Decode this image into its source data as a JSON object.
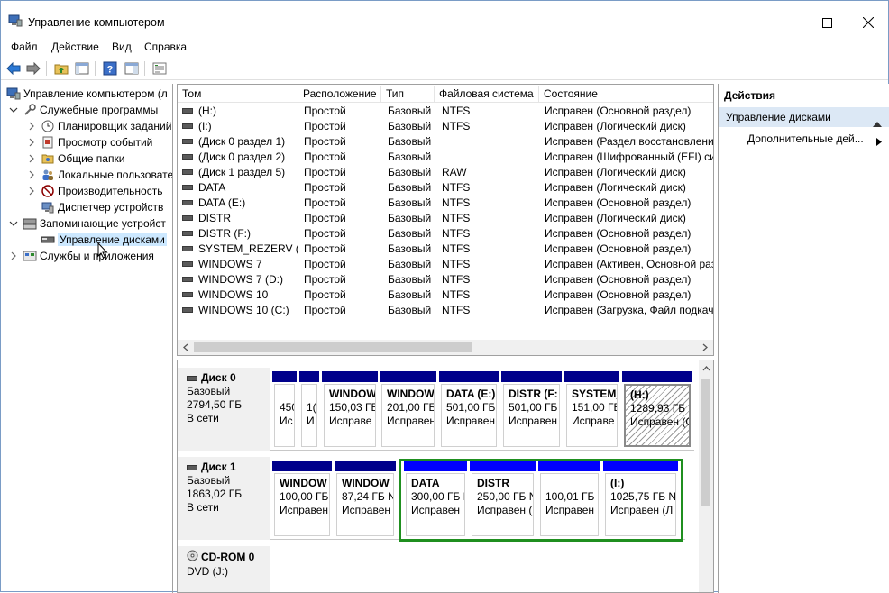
{
  "window": {
    "title": "Управление компьютером"
  },
  "menu": [
    "Файл",
    "Действие",
    "Вид",
    "Справка"
  ],
  "tree": {
    "root": "Управление компьютером (л",
    "items": [
      {
        "label": "Служебные программы",
        "level": 1,
        "expanded": true
      },
      {
        "label": "Планировщик заданий",
        "level": 2,
        "expanded": false
      },
      {
        "label": "Просмотр событий",
        "level": 2,
        "expanded": false
      },
      {
        "label": "Общие папки",
        "level": 2,
        "expanded": false
      },
      {
        "label": "Локальные пользовате",
        "level": 2,
        "expanded": false
      },
      {
        "label": "Производительность",
        "level": 2,
        "expanded": false
      },
      {
        "label": "Диспетчер устройств",
        "level": 2
      },
      {
        "label": "Запоминающие устройст",
        "level": 1,
        "expanded": true
      },
      {
        "label": "Управление дисками",
        "level": 2,
        "selected": true
      },
      {
        "label": "Службы и приложения",
        "level": 1,
        "expanded": false
      }
    ]
  },
  "volumes": {
    "columns": [
      "Том",
      "Расположение",
      "Тип",
      "Файловая система",
      "Состояние"
    ],
    "rows": [
      [
        "(H:)",
        "Простой",
        "Базовый",
        "NTFS",
        "Исправен (Основной раздел)"
      ],
      [
        "(I:)",
        "Простой",
        "Базовый",
        "NTFS",
        "Исправен (Логический диск)"
      ],
      [
        "(Диск 0 раздел 1)",
        "Простой",
        "Базовый",
        "",
        "Исправен (Раздел восстановления"
      ],
      [
        "(Диск 0 раздел 2)",
        "Простой",
        "Базовый",
        "",
        "Исправен (Шифрованный (EFI) си"
      ],
      [
        "(Диск 1 раздел 5)",
        "Простой",
        "Базовый",
        "RAW",
        "Исправен (Логический диск)"
      ],
      [
        "DATA",
        "Простой",
        "Базовый",
        "NTFS",
        "Исправен (Логический диск)"
      ],
      [
        "DATA (E:)",
        "Простой",
        "Базовый",
        "NTFS",
        "Исправен (Основной раздел)"
      ],
      [
        "DISTR",
        "Простой",
        "Базовый",
        "NTFS",
        "Исправен (Логический диск)"
      ],
      [
        "DISTR (F:)",
        "Простой",
        "Базовый",
        "NTFS",
        "Исправен (Основной раздел)"
      ],
      [
        "SYSTEM_REZERV (G:)",
        "Простой",
        "Базовый",
        "NTFS",
        "Исправен (Основной раздел)"
      ],
      [
        "WINDOWS 7",
        "Простой",
        "Базовый",
        "NTFS",
        "Исправен (Активен, Основной раз"
      ],
      [
        "WINDOWS 7 (D:)",
        "Простой",
        "Базовый",
        "NTFS",
        "Исправен (Основной раздел)"
      ],
      [
        "WINDOWS 10",
        "Простой",
        "Базовый",
        "NTFS",
        "Исправен (Основной раздел)"
      ],
      [
        "WINDOWS 10 (C:)",
        "Простой",
        "Базовый",
        "NTFS",
        "Исправен (Загрузка, Файл подкач"
      ]
    ]
  },
  "disks": [
    {
      "name": "Диск 0",
      "type": "Базовый",
      "size": "2794,50 ГБ",
      "status": "В сети",
      "partitions": [
        {
          "name": "",
          "size": "450",
          "status": "Ис"
        },
        {
          "name": "",
          "size": "1(",
          "status": "И"
        },
        {
          "name": "WINDOW",
          "size": "150,03 ГБ",
          "status": "Исправе"
        },
        {
          "name": "WINDOW",
          "size": "201,00 ГБ",
          "status": "Исправен"
        },
        {
          "name": "DATA  (E:)",
          "size": "501,00 ГБ",
          "status": "Исправен"
        },
        {
          "name": "DISTR  (F:",
          "size": "501,00 ГБ",
          "status": "Исправен"
        },
        {
          "name": "SYSTEM_",
          "size": "151,00 ГБ",
          "status": "Исправе"
        },
        {
          "name": "(H:)",
          "size": "1289,93 ГБ N",
          "status": "Исправен (С"
        }
      ]
    },
    {
      "name": "Диск 1",
      "type": "Базовый",
      "size": "1863,02 ГБ",
      "status": "В сети",
      "partitions": [
        {
          "name": "WINDOW",
          "size": "100,00 ГБ N",
          "status": "Исправен"
        },
        {
          "name": "WINDOW",
          "size": "87,24 ГБ N",
          "status": "Исправен"
        },
        {
          "name": "DATA",
          "size": "300,00 ГБ N",
          "status": "Исправен"
        },
        {
          "name": "DISTR",
          "size": "250,00 ГБ N",
          "status": "Исправен ("
        },
        {
          "name": "",
          "size": "100,01 ГБ F",
          "status": "Исправен"
        },
        {
          "name": "(I:)",
          "size": "1025,75 ГБ N",
          "status": "Исправен (Л"
        }
      ]
    },
    {
      "name": "CD-ROM 0",
      "type": "DVD (J:)"
    }
  ],
  "actions": {
    "title": "Действия",
    "section": "Управление дисками",
    "item": "Дополнительные дей..."
  }
}
